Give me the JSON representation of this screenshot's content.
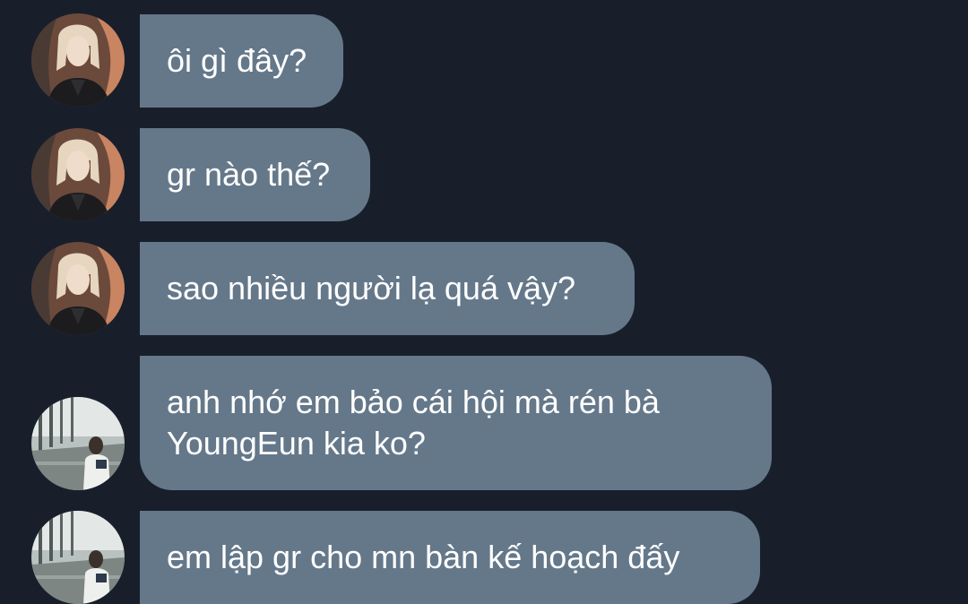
{
  "messages": [
    {
      "text": "ôi gì đây?",
      "sender": "blonde-user"
    },
    {
      "text": "gr nào thế?",
      "sender": "blonde-user"
    },
    {
      "text": "sao nhiều người lạ quá vậy?",
      "sender": "blonde-user"
    },
    {
      "text": "anh nhớ em bảo cái hội mà rén bà\nYoungEun kia ko?",
      "sender": "airport-user"
    },
    {
      "text": "em lập gr cho mn bàn kế hoạch đấy",
      "sender": "airport-user"
    }
  ],
  "colors": {
    "background": "#181f2b",
    "bubble": "#65788a",
    "text": "#ffffff"
  }
}
